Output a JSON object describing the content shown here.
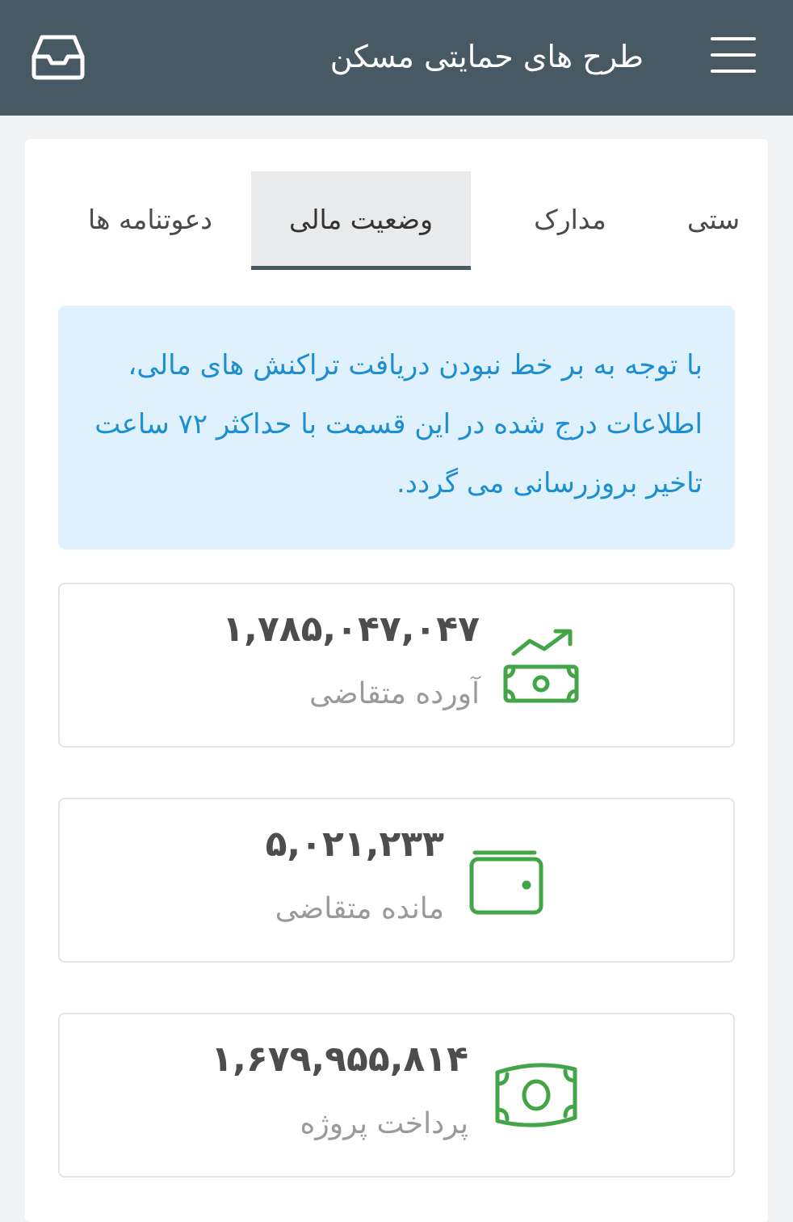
{
  "header": {
    "title": "طرح های حمایتی مسکن",
    "menu_icon": "hamburger-menu-icon",
    "inbox_icon": "inbox-tray-icon"
  },
  "tabs": [
    {
      "label": "ستی"
    },
    {
      "label": "مدارک"
    },
    {
      "label": "وضعیت مالی",
      "active": true
    },
    {
      "label": "دعوتنامه ها"
    }
  ],
  "notice": {
    "text": "با توجه به بر خط نبودن دریافت تراکنش های مالی، اطلاعات درج شده در این قسمت با حداکثر ۷۲ ساعت تاخیر بروزرسانی می گردد."
  },
  "stats": [
    {
      "value": "۱,۷۸۵,۰۴۷,۰۴۷",
      "label": "آورده متقاضی",
      "icon": "money-growth-icon"
    },
    {
      "value": "۵,۰۲۱,۲۳۳",
      "label": "مانده متقاضی",
      "icon": "wallet-icon"
    },
    {
      "value": "۱,۶۷۹,۹۵۵,۸۱۴",
      "label": "پرداخت پروژه",
      "icon": "banknote-icon"
    }
  ],
  "colors": {
    "header": "#475a64",
    "notice_bg": "#dff1fc",
    "notice_text": "#1d8ed1",
    "icon_green": "#43a547"
  }
}
